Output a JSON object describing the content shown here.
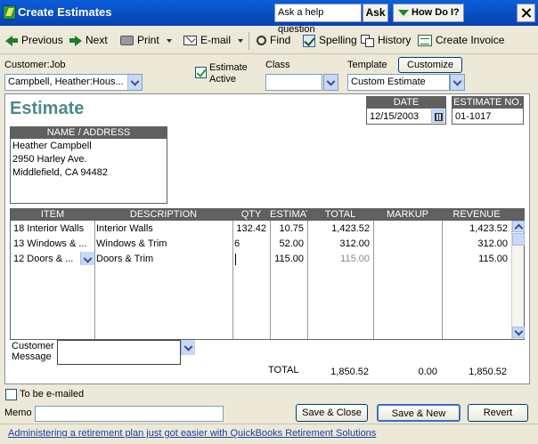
{
  "window": {
    "title": "Create Estimates",
    "help_placeholder": "Ask a help question",
    "ask_label": "Ask",
    "how_do_i_label": "How Do I?"
  },
  "toolbar": {
    "previous": "Previous",
    "next": "Next",
    "print": "Print",
    "email": "E-mail",
    "find": "Find",
    "spelling": "Spelling",
    "history": "History",
    "create_invoice": "Create Invoice"
  },
  "header": {
    "customer_job_label": "Customer:Job",
    "customer_job_value": "Campbell, Heather:Hous...",
    "estimate_active_label_1": "Estimate",
    "estimate_active_label_2": "Active",
    "estimate_active_checked": true,
    "class_label": "Class",
    "class_value": "",
    "template_label": "Template",
    "customize_label": "Customize",
    "template_value": "Custom Estimate"
  },
  "form": {
    "title": "Estimate",
    "date_label": "DATE",
    "date_value": "12/15/2003",
    "estimate_no_label": "ESTIMATE NO.",
    "estimate_no_value": "01-1017",
    "name_address_label": "NAME / ADDRESS",
    "address_lines": [
      "Heather Campbell",
      "2950 Harley Ave.",
      "Middlefield, CA 94482"
    ]
  },
  "table": {
    "columns": [
      "ITEM",
      "DESCRIPTION",
      "QTY",
      "ESTIMAT",
      "TOTAL",
      "MARKUP",
      "REVENUE"
    ],
    "rows": [
      {
        "item": "18 Interior Walls",
        "description": "Interior Walls",
        "qty": "132.42",
        "estimate": "10.75",
        "total": "1,423.52",
        "markup": "",
        "revenue": "1,423.52"
      },
      {
        "item": "13 Windows & ...",
        "description": "Windows & Trim",
        "qty": "6",
        "estimate": "52.00",
        "total": "312.00",
        "markup": "",
        "revenue": "312.00"
      },
      {
        "item": "12 Doors & ...",
        "description": "Doors & Trim",
        "qty": "",
        "estimate": "115.00",
        "total": "115.00",
        "markup": "",
        "revenue": "115.00"
      }
    ]
  },
  "customer_message": {
    "label_1": "Customer",
    "label_2": "Message",
    "value": ""
  },
  "totals": {
    "label": "TOTAL",
    "total": "1,850.52",
    "markup": "0.00",
    "revenue": "1,850.52"
  },
  "bottom": {
    "to_be_emailed_label": "To be e-mailed",
    "to_be_emailed_checked": false,
    "memo_label": "Memo",
    "memo_value": "",
    "save_close": "Save & Close",
    "save_new": "Save & New",
    "revert": "Revert",
    "promo_link": "Administering a retirement plan just got easier with QuickBooks Retirement Solutions"
  },
  "colors": {
    "titlebar": "#0a5fd8",
    "estimate_title": "#4d8a8a",
    "header_gray": "#606060",
    "link": "#1a3fa3"
  }
}
